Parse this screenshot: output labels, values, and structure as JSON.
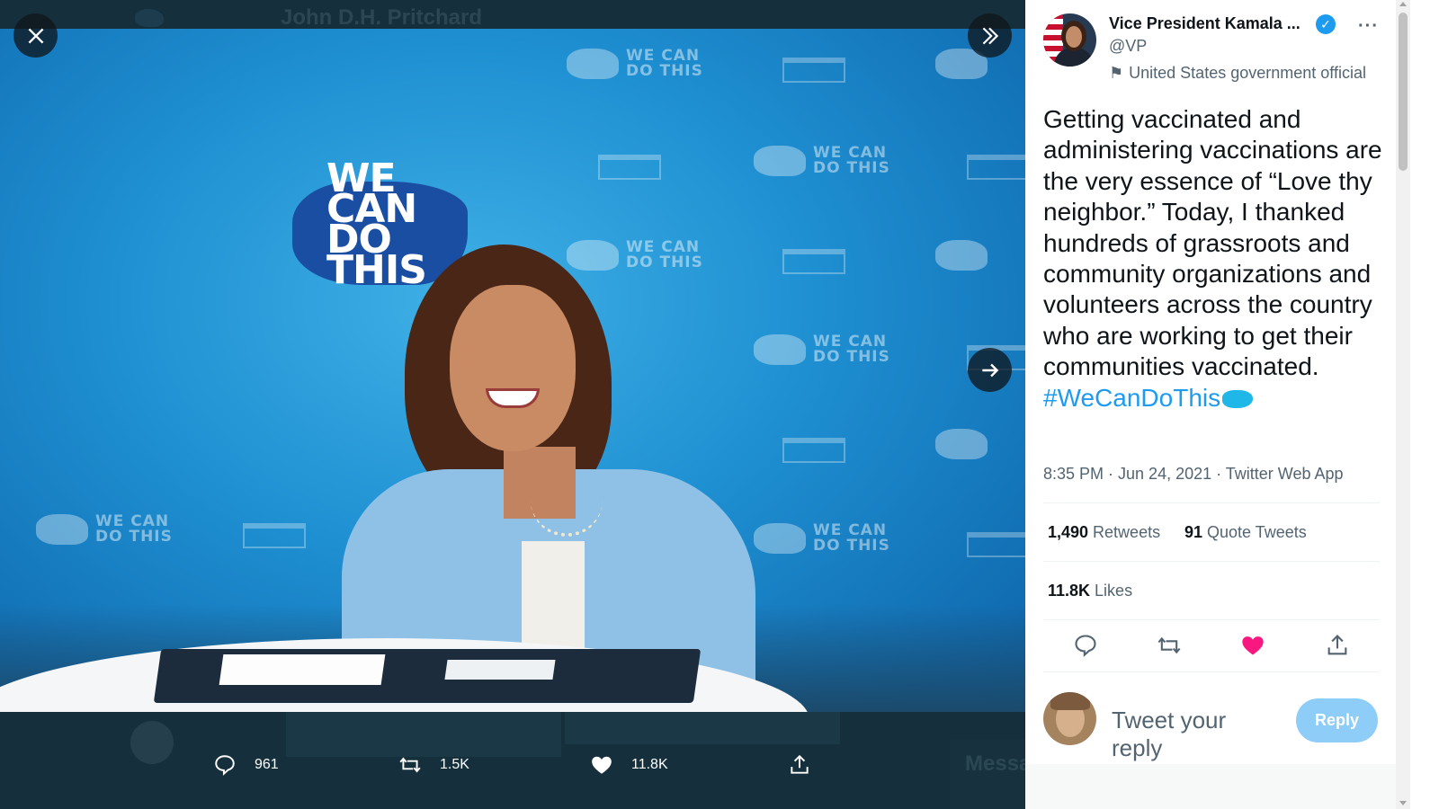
{
  "background": {
    "profile_name": "John D.H. Pritchard",
    "messages_label": "Messa"
  },
  "viewer": {
    "close_icon": "close-icon",
    "collapse_icon": "double-chevron-right-icon",
    "next_icon": "arrow-right-icon",
    "photo_slogan": [
      "WE",
      "CAN",
      "DO",
      "THIS"
    ],
    "tile_text": "WE CAN DO THIS",
    "actions": {
      "replies": "961",
      "retweets": "1.5K",
      "likes": "11.8K"
    }
  },
  "tweet": {
    "author_name": "Vice President Kamala ...",
    "author_handle": "@VP",
    "affiliation": "United States government official",
    "text": "Getting vaccinated and administering vaccinations are the very essence of “Love thy neighbor.” Today, I thanked hundreds of grassroots and community organizations and volunteers across the country who are working to get their communities vaccinated.",
    "hashtag": "#WeCanDoThis",
    "meta": "8:35 PM · Jun 24, 2021 · Twitter Web App",
    "stats": {
      "retweets_count": "1,490",
      "retweets_label": "Retweets",
      "quotes_count": "91",
      "quotes_label": "Quote Tweets",
      "likes_count": "11.8K",
      "likes_label": "Likes"
    },
    "liked": true,
    "accent_color": "#1d9bf0",
    "like_color": "#f91880"
  },
  "reply": {
    "placeholder": "Tweet your reply",
    "button_label": "Reply"
  }
}
